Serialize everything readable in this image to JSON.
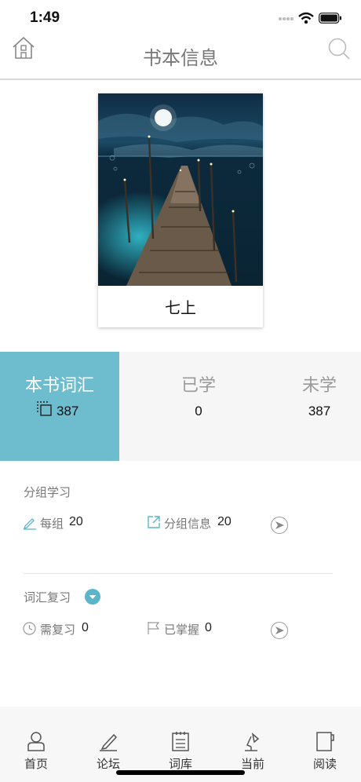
{
  "status_bar": {
    "time": "1:49"
  },
  "header": {
    "title": "书本信息"
  },
  "book": {
    "name": "七上"
  },
  "stats": {
    "total_label": "本书词汇",
    "total_value": "387",
    "learned_label": "已学",
    "learned_value": "0",
    "unlearned_label": "未学",
    "unlearned_value": "387"
  },
  "group_study": {
    "title": "分组学习",
    "per_group_label": "每组",
    "per_group_value": "20",
    "group_info_label": "分组信息",
    "group_info_value": "20"
  },
  "vocab_review": {
    "title": "词汇复习",
    "need_review_label": "需复习",
    "need_review_value": "0",
    "mastered_label": "已掌握",
    "mastered_value": "0"
  },
  "tabbar": {
    "items": [
      {
        "label": "首页",
        "icon": "person-icon"
      },
      {
        "label": "论坛",
        "icon": "pen-icon"
      },
      {
        "label": "词库",
        "icon": "notepad-icon"
      },
      {
        "label": "当前",
        "icon": "lamp-icon"
      },
      {
        "label": "阅读",
        "icon": "book-icon"
      }
    ]
  },
  "colors": {
    "accent": "#6dbdcf",
    "stats_bg": "#f6f6f6",
    "tabbar_bg": "#f7f7f7"
  }
}
